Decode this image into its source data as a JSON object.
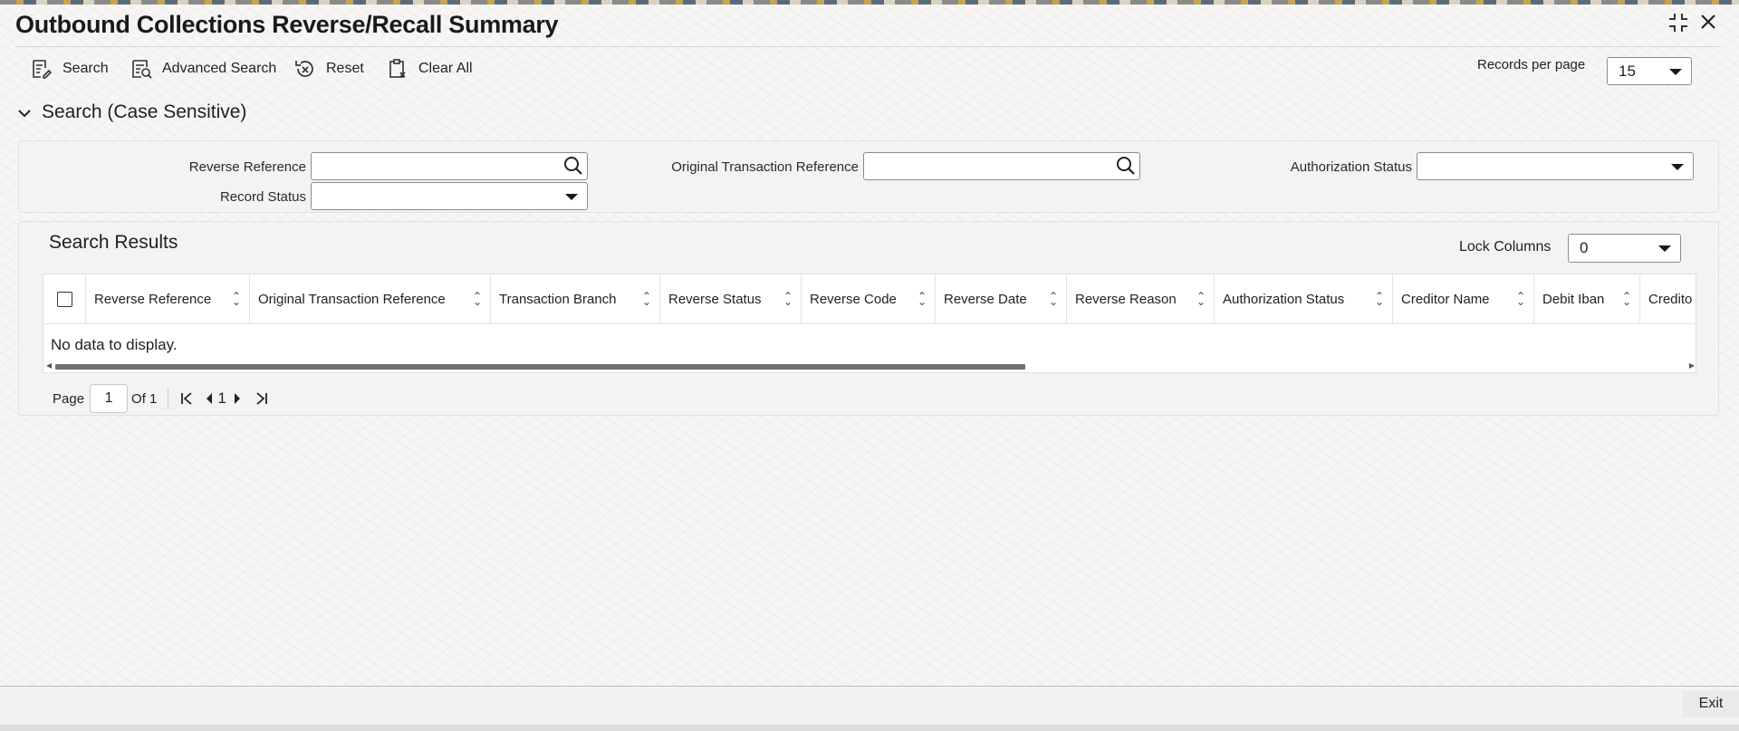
{
  "window": {
    "title": "Outbound Collections Reverse/Recall Summary",
    "minimize_icon": "collapse-icon",
    "close_icon": "close-icon"
  },
  "toolbar": {
    "search_label": "Search",
    "advanced_search_label": "Advanced Search",
    "reset_label": "Reset",
    "clear_all_label": "Clear All",
    "records_per_page_label": "Records per page",
    "records_per_page_value": "15"
  },
  "search_section": {
    "title": "Search (Case Sensitive)",
    "fields": {
      "reverse_reference_label": "Reverse Reference",
      "reverse_reference_value": "",
      "original_txn_reference_label": "Original Transaction Reference",
      "original_txn_reference_value": "",
      "authorization_status_label": "Authorization Status",
      "authorization_status_value": "",
      "record_status_label": "Record Status",
      "record_status_value": ""
    }
  },
  "results": {
    "title": "Search Results",
    "lock_columns_label": "Lock Columns",
    "lock_columns_value": "0",
    "columns": [
      "Reverse Reference",
      "Original Transaction Reference",
      "Transaction Branch",
      "Reverse Status",
      "Reverse Code",
      "Reverse Date",
      "Reverse Reason",
      "Authorization Status",
      "Creditor Name",
      "Debit Iban",
      "Credito"
    ],
    "empty_message": "No data to display."
  },
  "pagination": {
    "page_label": "Page",
    "page_value": "1",
    "of_label": "Of 1",
    "current_page": "1"
  },
  "footer": {
    "exit_label": "Exit"
  }
}
